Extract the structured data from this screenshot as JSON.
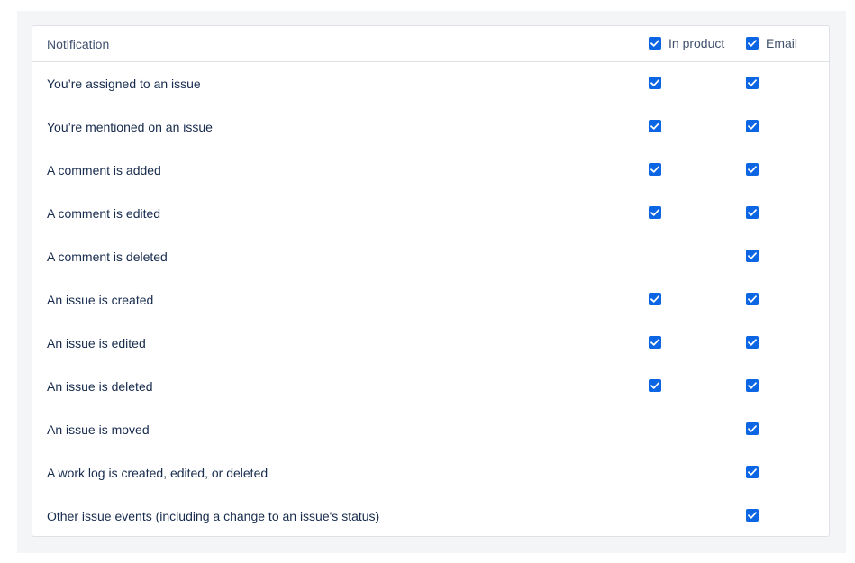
{
  "colors": {
    "panel_bg": "#f4f5f7",
    "border": "#dfe1e6",
    "checkbox": "#0c66e4",
    "header_text": "#42526e",
    "row_text": "#172b4d"
  },
  "table": {
    "header": {
      "notification_label": "Notification",
      "in_product_label": "In product",
      "in_product_checked": true,
      "email_label": "Email",
      "email_checked": true
    },
    "rows": [
      {
        "label": "You’re assigned to an issue",
        "in_product": true,
        "email": true
      },
      {
        "label": "You’re mentioned on an issue",
        "in_product": true,
        "email": true
      },
      {
        "label": "A comment is added",
        "in_product": true,
        "email": true
      },
      {
        "label": "A comment is edited",
        "in_product": true,
        "email": true
      },
      {
        "label": "A comment is deleted",
        "in_product": false,
        "email": true
      },
      {
        "label": "An issue is created",
        "in_product": true,
        "email": true
      },
      {
        "label": "An issue is edited",
        "in_product": true,
        "email": true
      },
      {
        "label": "An issue is deleted",
        "in_product": true,
        "email": true
      },
      {
        "label": "An issue is moved",
        "in_product": false,
        "email": true
      },
      {
        "label": "A work log is created, edited, or deleted",
        "in_product": false,
        "email": true
      },
      {
        "label": "Other issue events (including a change to an issue's status)",
        "in_product": false,
        "email": true
      }
    ]
  }
}
